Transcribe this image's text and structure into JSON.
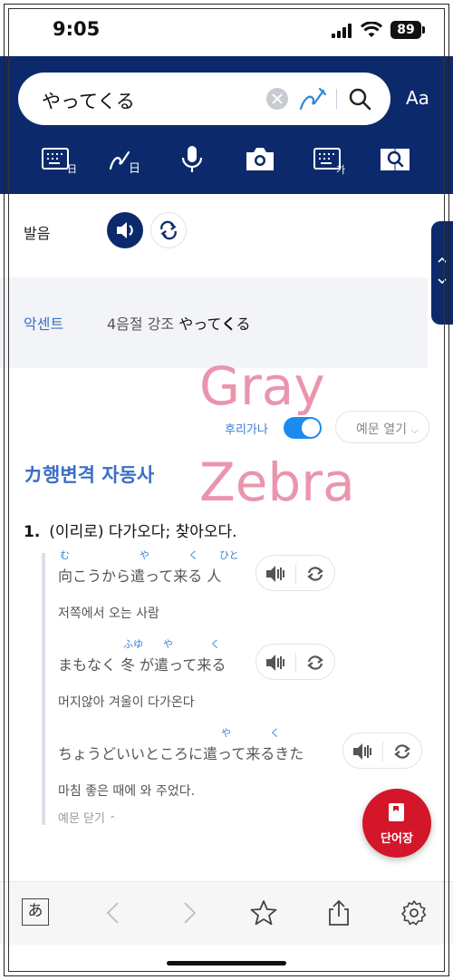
{
  "status_bar": {
    "time": "9:05",
    "battery": "89"
  },
  "search": {
    "query": "やってくる",
    "font_button": "Aa"
  },
  "tools": [
    "keyboard-input-icon",
    "handwriting-input-icon",
    "microphone-icon",
    "camera-icon",
    "korean-keyboard-icon",
    "book-search-icon"
  ],
  "pronunciation": {
    "label": "발음"
  },
  "accent": {
    "label": "악센트",
    "prefix": "4음절 강조",
    "word_normal": "やって",
    "word_stressed": "く",
    "word_end": "る"
  },
  "controls": {
    "furigana_label": "후리가나",
    "furigana_on": true,
    "open_examples": "예문 열기"
  },
  "entry": {
    "pos": "カ행변격 자동사",
    "def_number": "1.",
    "definition": "(이리로) 다가오다; 찾아오다.",
    "examples": [
      {
        "sentence": "向こうから遣って来る 人",
        "ruby": [
          "む",
          "や",
          "く",
          "ひと"
        ],
        "translation": "저쪽에서 오는 사람"
      },
      {
        "sentence": "まもなく 冬 が遣って来る",
        "ruby": [
          "ふゆ",
          "や",
          "く"
        ],
        "translation": "머지않아 겨울이 다가온다"
      },
      {
        "sentence": "ちょうどいいところに遣って来るきた",
        "ruby": [
          "や",
          "く"
        ],
        "translation": "마침 좋은 때에 와 주었다."
      }
    ],
    "close_examples": "예문 닫기"
  },
  "vocab_button": "단어장",
  "watermark": {
    "line1": "Gray",
    "line2": "Zebra"
  },
  "bottom_bar": {
    "kana": "あ"
  },
  "colors": {
    "header": "#0c2a6b",
    "accent_blue": "#3a6fc4",
    "vocab_red": "#d3162a"
  }
}
